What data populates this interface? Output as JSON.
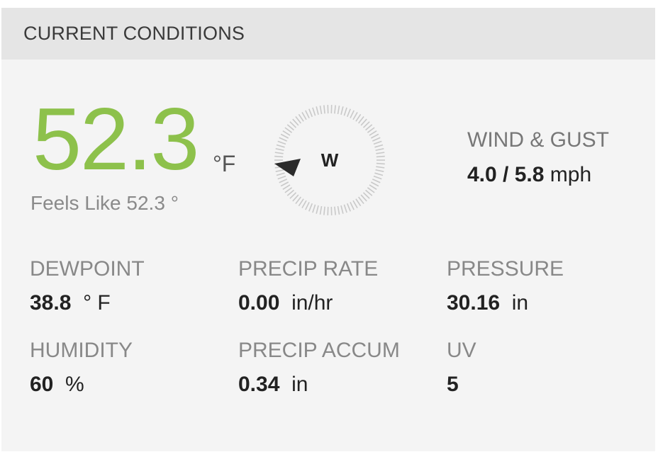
{
  "header": {
    "title": "CURRENT CONDITIONS"
  },
  "temperature": {
    "value": "52.3",
    "unit": "°F",
    "feels_like_label": "Feels Like",
    "feels_like_value": "52.3",
    "feels_like_unit": "°",
    "color": "#8dc14b"
  },
  "compass": {
    "direction": "W",
    "bearing_deg": 270,
    "icon": "wind-direction-arrow-icon"
  },
  "wind": {
    "label": "WIND & GUST",
    "speed": "4.0",
    "separator": " / ",
    "gust": "5.8",
    "unit": "mph"
  },
  "metrics": {
    "dewpoint": {
      "label": "DEWPOINT",
      "value": "38.8",
      "unit": "° F"
    },
    "precip_rate": {
      "label": "PRECIP RATE",
      "value": "0.00",
      "unit": "in/hr"
    },
    "pressure": {
      "label": "PRESSURE",
      "value": "30.16",
      "unit": "in"
    },
    "humidity": {
      "label": "HUMIDITY",
      "value": "60",
      "unit": "%"
    },
    "precip_accum": {
      "label": "PRECIP ACCUM",
      "value": "0.34",
      "unit": "in"
    },
    "uv": {
      "label": "UV",
      "value": "5"
    }
  }
}
